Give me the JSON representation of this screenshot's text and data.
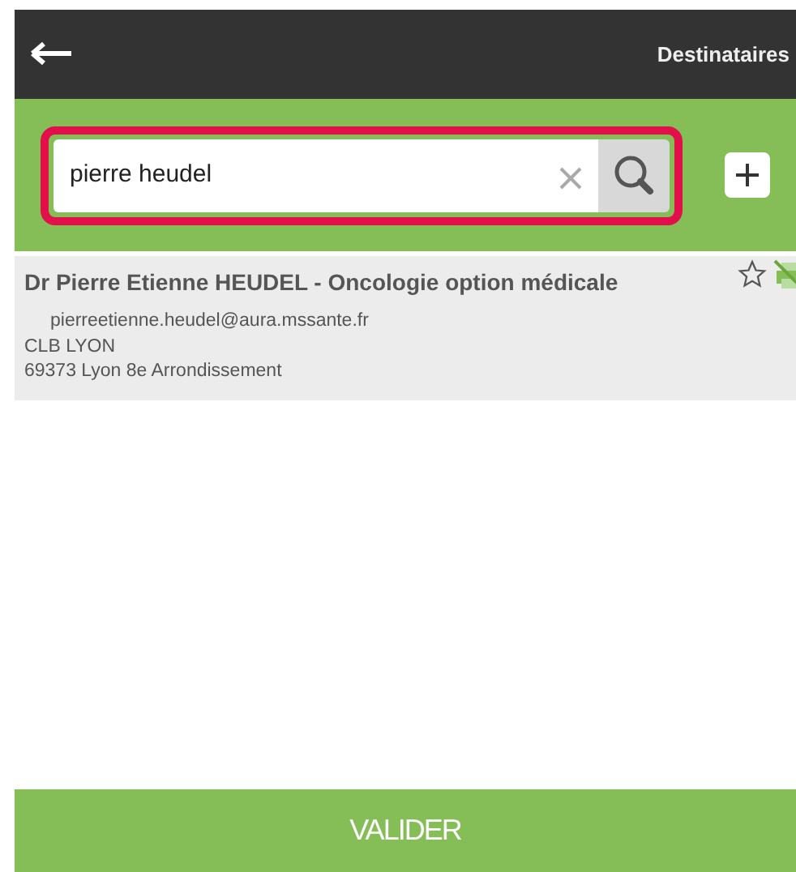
{
  "header": {
    "title": "Destinataires"
  },
  "search": {
    "value": "pierre heudel"
  },
  "results": [
    {
      "name": "Dr Pierre Etienne HEUDEL - Oncologie option médicale",
      "email": "pierreetienne.heudel@aura.mssante.fr",
      "organization": "CLB LYON",
      "address": "69373 Lyon 8e Arrondissement",
      "favorite": false
    }
  ],
  "footer": {
    "button": "VALIDER"
  }
}
